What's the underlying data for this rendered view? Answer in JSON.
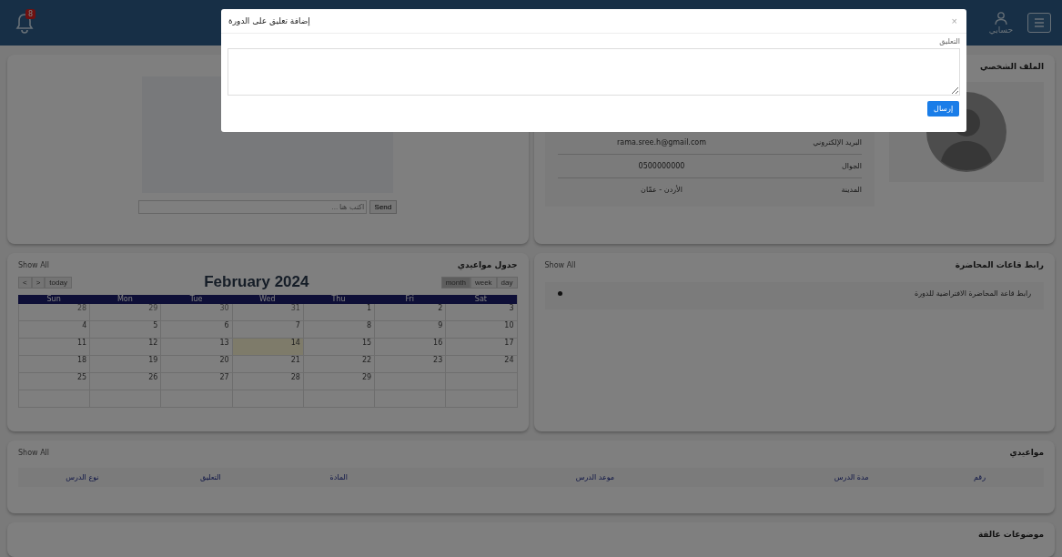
{
  "header": {
    "notification_badge": "8",
    "account_label": "حسابي"
  },
  "chat": {
    "placeholder": "اكتب هنا ...",
    "send_button": "Send"
  },
  "profile": {
    "title": "الملف الشخصي",
    "rows": [
      {
        "label": "البريد الإلكتروني",
        "value": "rama.sree.h@gmail.com"
      },
      {
        "label": "الجوال",
        "value": "0500000000"
      },
      {
        "label": "المدينة",
        "value": "الأردن - عمّان"
      }
    ]
  },
  "calendar": {
    "title": "جدول مواعيدي",
    "show_all": "Show All",
    "nav_buttons": [
      "today",
      ">",
      "<"
    ],
    "month_title": "February 2024",
    "view_buttons": [
      {
        "label": "day",
        "selected": false
      },
      {
        "label": "week",
        "selected": false
      },
      {
        "label": "month",
        "selected": true
      }
    ],
    "weekdays": [
      "Sat",
      "Fri",
      "Thu",
      "Wed",
      "Tue",
      "Mon",
      "Sun"
    ],
    "weeks": [
      [
        {
          "day": "3",
          "other_month": false,
          "today": false
        },
        {
          "day": "2",
          "other_month": false,
          "today": false
        },
        {
          "day": "1",
          "other_month": false,
          "today": false
        },
        {
          "day": "31",
          "other_month": true,
          "today": false
        },
        {
          "day": "30",
          "other_month": true,
          "today": false
        },
        {
          "day": "29",
          "other_month": true,
          "today": false
        },
        {
          "day": "28",
          "other_month": true,
          "today": false
        }
      ],
      [
        {
          "day": "10",
          "other_month": false,
          "today": false
        },
        {
          "day": "9",
          "other_month": false,
          "today": false
        },
        {
          "day": "8",
          "other_month": false,
          "today": false
        },
        {
          "day": "7",
          "other_month": false,
          "today": false
        },
        {
          "day": "6",
          "other_month": false,
          "today": false
        },
        {
          "day": "5",
          "other_month": false,
          "today": false
        },
        {
          "day": "4",
          "other_month": false,
          "today": false
        }
      ],
      [
        {
          "day": "17",
          "other_month": false,
          "today": false
        },
        {
          "day": "16",
          "other_month": false,
          "today": false
        },
        {
          "day": "15",
          "other_month": false,
          "today": false
        },
        {
          "day": "14",
          "other_month": false,
          "today": true
        },
        {
          "day": "13",
          "other_month": false,
          "today": false
        },
        {
          "day": "12",
          "other_month": false,
          "today": false
        },
        {
          "day": "11",
          "other_month": false,
          "today": false
        }
      ],
      [
        {
          "day": "24",
          "other_month": false,
          "today": false
        },
        {
          "day": "23",
          "other_month": false,
          "today": false
        },
        {
          "day": "22",
          "other_month": false,
          "today": false
        },
        {
          "day": "21",
          "other_month": false,
          "today": false
        },
        {
          "day": "20",
          "other_month": false,
          "today": false
        },
        {
          "day": "19",
          "other_month": false,
          "today": false
        },
        {
          "day": "18",
          "other_month": false,
          "today": false
        }
      ],
      [
        {
          "day": "29",
          "other_month": false,
          "today": false
        },
        {
          "day": "28",
          "other_month": false,
          "today": false
        },
        {
          "day": "27",
          "other_month": false,
          "today": false
        },
        {
          "day": "26",
          "other_month": false,
          "today": false
        },
        {
          "day": "25",
          "other_month": false,
          "today": false
        }
      ]
    ]
  },
  "links": {
    "title": "رابط قاعات المحاضرة",
    "show_all": "Show All",
    "items": [
      {
        "text": "رابط قاعة المحاضرة الافتراضية للدورة"
      }
    ]
  },
  "appointments": {
    "title": "مواعيدي",
    "show_all": "Show All",
    "columns": [
      "رقم",
      "مدة الدرس",
      "موعد الدرس",
      "المادة",
      "التعليق",
      "نوع الدرس"
    ]
  },
  "pending": {
    "title": "موضوعات عالقة"
  },
  "modal": {
    "title": "إضافة تعليق على الدورة",
    "close": "×",
    "field_label": "التعليق",
    "submit_button": "إرسال"
  }
}
